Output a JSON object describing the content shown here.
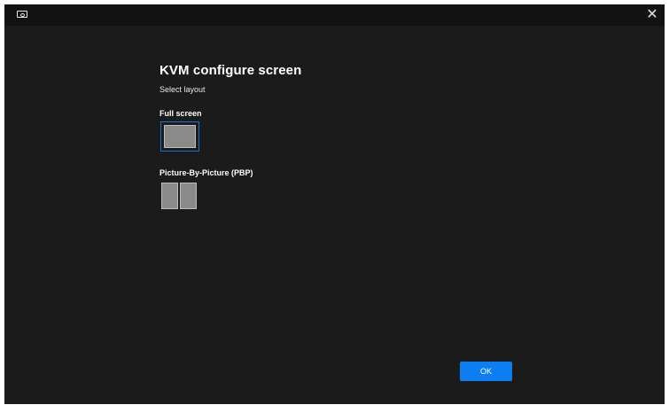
{
  "window": {
    "icon": "display-icon",
    "close_glyph": "✕"
  },
  "main": {
    "title": "KVM configure screen",
    "subtitle": "Select layout",
    "layouts": [
      {
        "label": "Full screen",
        "selected": true
      },
      {
        "label": "Picture-By-Picture (PBP)",
        "selected": false
      }
    ]
  },
  "footer": {
    "ok_label": "OK"
  },
  "colors": {
    "accent": "#0c7ef2",
    "background": "#1b1b1b",
    "titlebar": "#121212"
  }
}
